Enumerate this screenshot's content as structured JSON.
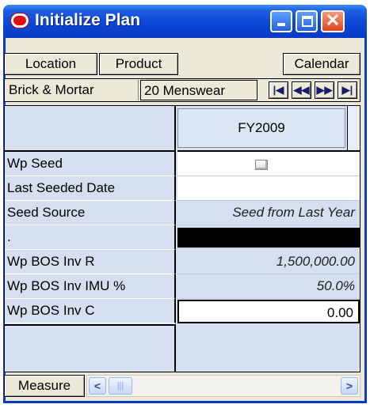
{
  "window": {
    "title": "Initialize Plan"
  },
  "toolbar": {
    "location_label": "Location",
    "product_label": "Product",
    "calendar_label": "Calendar"
  },
  "position": {
    "location_value": "Brick & Mortar",
    "product_value": "20 Menswear"
  },
  "nav_icons": [
    "first-page-icon",
    "previous-page-icon",
    "next-page-icon",
    "last-page-icon"
  ],
  "grid": {
    "column_header": "FY2009",
    "rows": [
      {
        "label": "Wp Seed",
        "value": ""
      },
      {
        "label": "Last Seeded Date",
        "value": ""
      },
      {
        "label": "Seed Source",
        "value": "Seed from Last Year"
      },
      {
        "label": ".",
        "value": ""
      },
      {
        "label": "Wp BOS Inv R",
        "value": "1,500,000.00"
      },
      {
        "label": "Wp BOS Inv IMU %",
        "value": "50.0%"
      },
      {
        "label": "Wp BOS Inv C",
        "value": "0.00"
      }
    ]
  },
  "footer": {
    "measure_label": "Measure"
  },
  "colors": {
    "titlebar": "#0a3bc4",
    "grid_label_bg": "#d6dff0",
    "window_bg": "#ece9d8"
  }
}
